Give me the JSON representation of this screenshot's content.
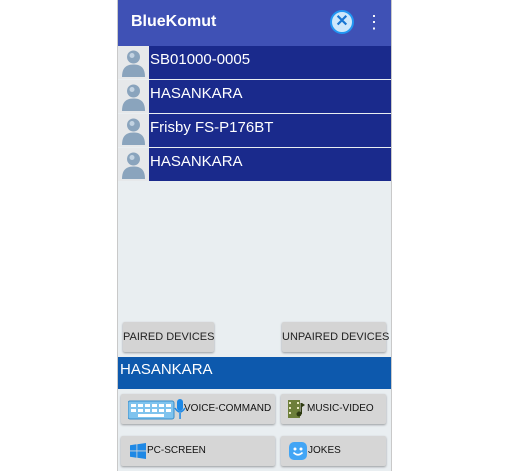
{
  "app": {
    "title": "BlueKomut",
    "close_icon": "close-circle-icon",
    "menu_icon": "more-vertical-icon",
    "menu_glyph": "⋮",
    "close_glyph": "✕"
  },
  "devices": [
    {
      "name": "SB01000-0005",
      "icon": "user-avatar-icon"
    },
    {
      "name": "HASANKARA",
      "icon": "user-avatar-icon"
    },
    {
      "name": "Frisby FS-P176BT",
      "icon": "user-avatar-icon"
    },
    {
      "name": "HASANKARA",
      "icon": "user-avatar-icon"
    }
  ],
  "tabs": {
    "paired": "PAIRED DEVICES",
    "unpaired": "UNPAIRED DEVICES"
  },
  "selected_device": "HASANKARA",
  "actions": {
    "voice_command": {
      "label": "VOICE-COMMAND",
      "icon": "keyboard-microphone-icon"
    },
    "music_video": {
      "label": "MUSIC-VIDEO",
      "icon": "film-music-icon"
    },
    "pc_screen": {
      "label": "PC-SCREEN",
      "icon": "windows-logo-icon"
    },
    "jokes": {
      "label": "JOKES",
      "icon": "smiley-icon"
    }
  },
  "colors": {
    "appbar": "#3f51b5",
    "device_row": "#1a2a8c",
    "selected_bar": "#0d59ad",
    "background": "#e9eef1",
    "button": "#d6d6d6"
  }
}
